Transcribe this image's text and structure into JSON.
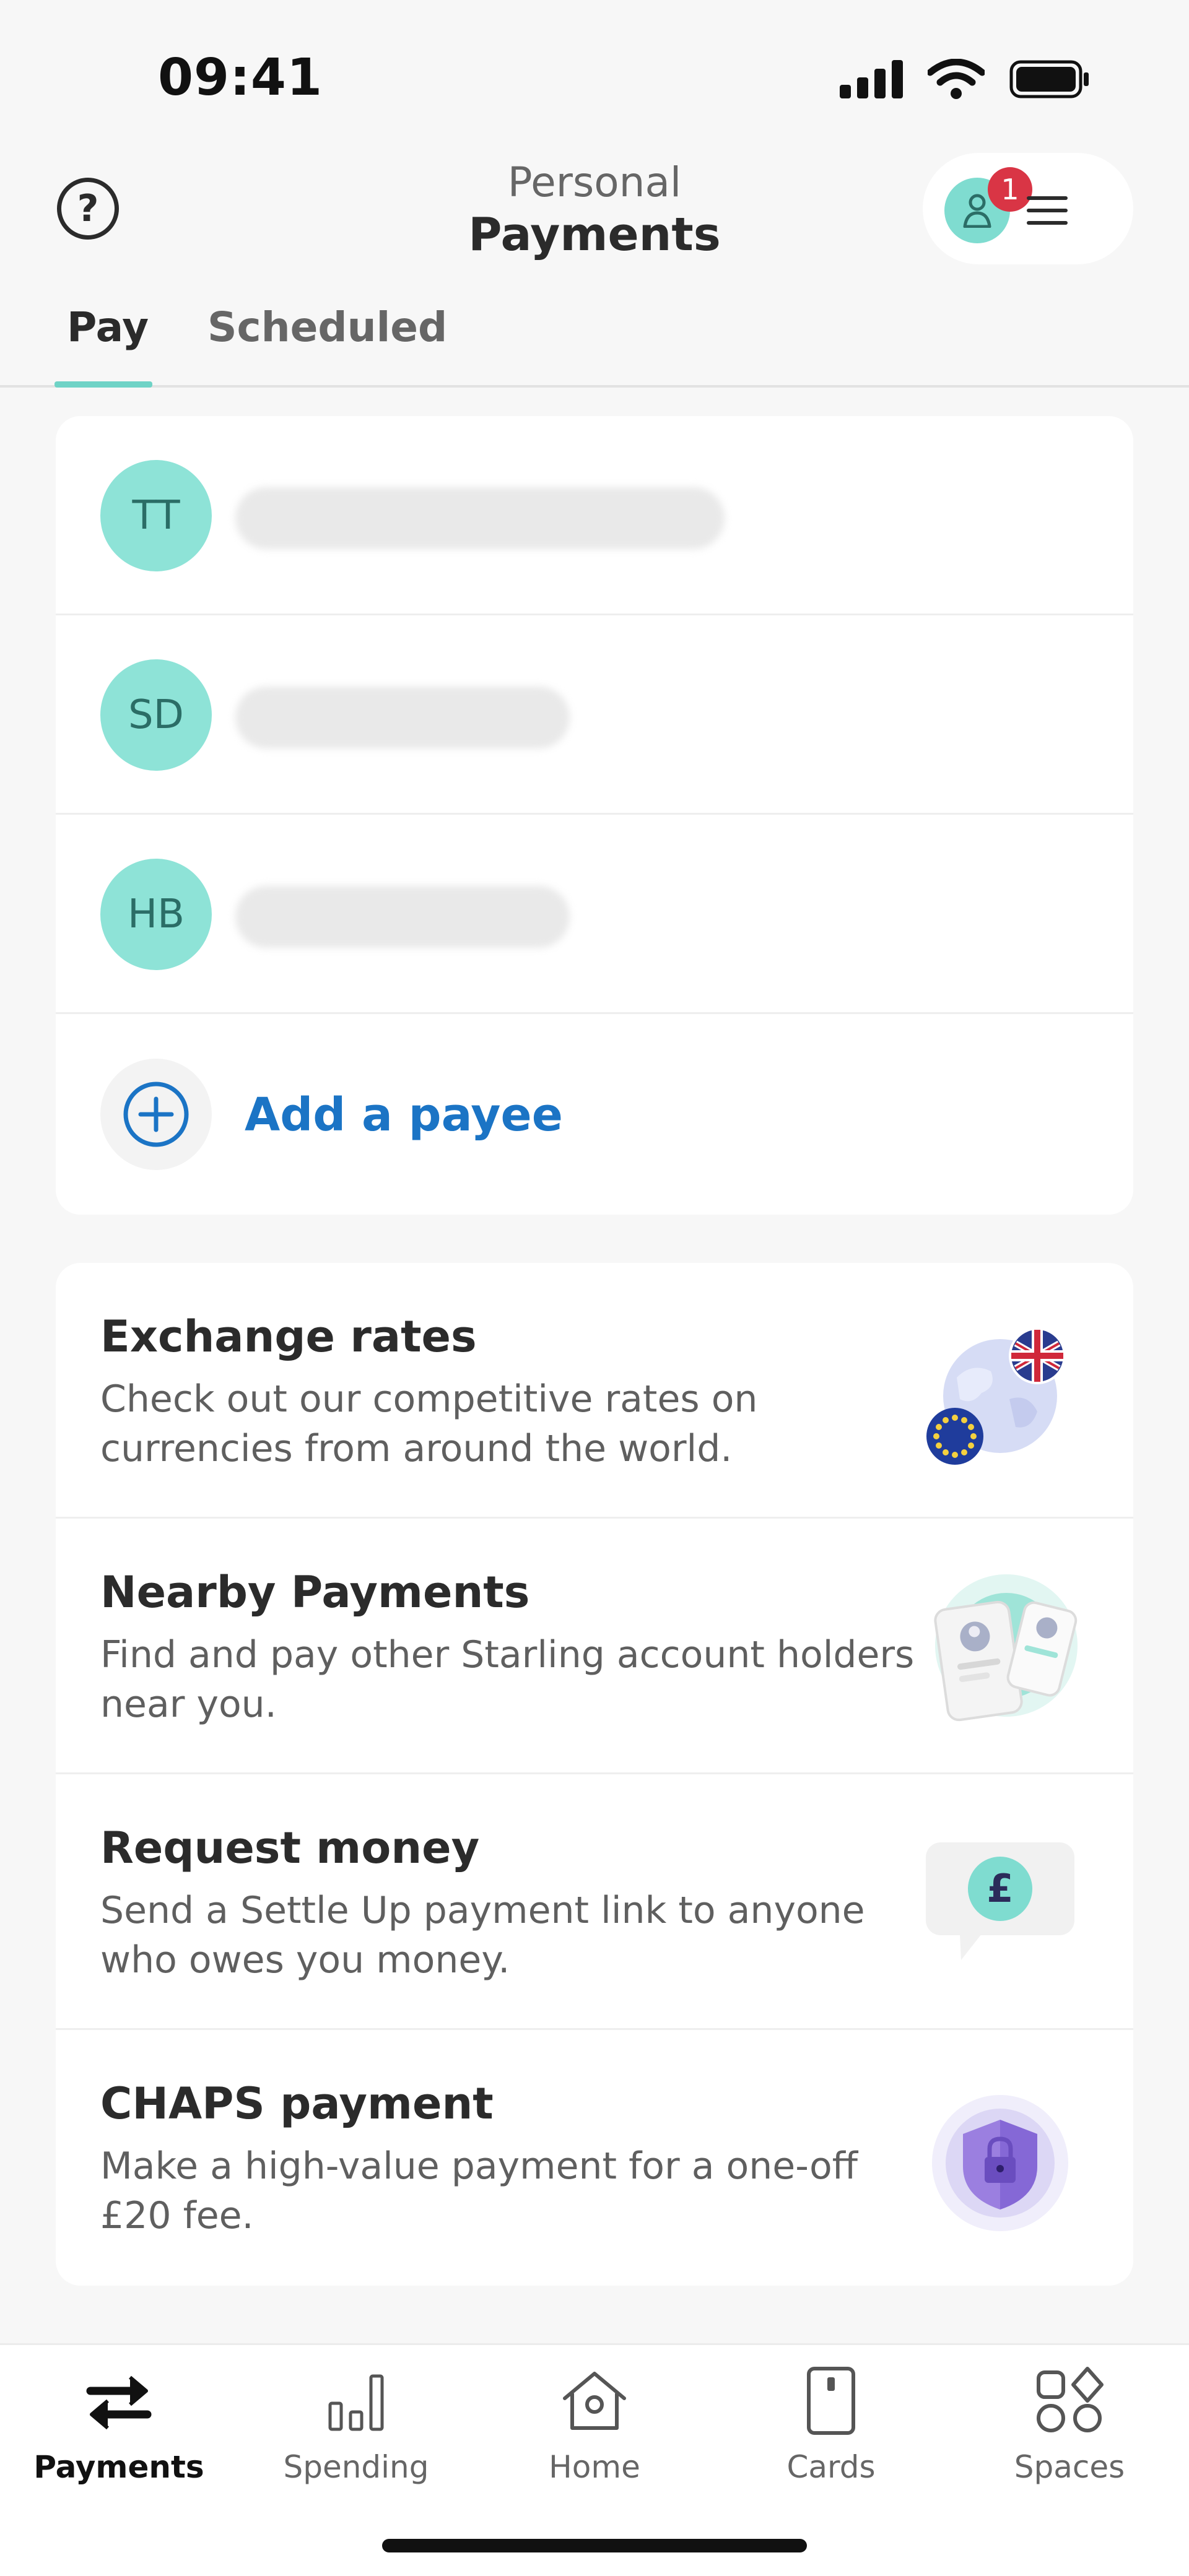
{
  "status_bar": {
    "time": "09:41",
    "icons": [
      "signal-icon",
      "wifi-icon",
      "battery-icon"
    ]
  },
  "header": {
    "subtitle": "Personal",
    "title": "Payments",
    "help_icon": "question-circle-icon",
    "profile_icon": "person-icon",
    "notification_count": "1",
    "menu_icon": "hamburger-menu-icon"
  },
  "tabs": [
    {
      "label": "Pay",
      "active": true
    },
    {
      "label": "Scheduled",
      "active": false
    }
  ],
  "payees": [
    {
      "initials": "TT"
    },
    {
      "initials": "SD"
    },
    {
      "initials": "HB"
    }
  ],
  "add_payee": {
    "label": "Add a payee",
    "icon": "plus-circle-icon"
  },
  "services": [
    {
      "title": "Exchange rates",
      "description": "Check out our competitive rates on currencies from around the world.",
      "icon": "globe-flags-icon"
    },
    {
      "title": "Nearby Payments",
      "description": "Find and pay other Starling account holders near you.",
      "icon": "nearby-phones-icon"
    },
    {
      "title": "Request money",
      "description": "Send a Settle Up payment link to anyone who owes you money.",
      "icon": "pound-speech-bubble-icon"
    },
    {
      "title": "CHAPS payment",
      "description": "Make a high-value payment for a one-off £20 fee.",
      "icon": "shield-lock-icon"
    }
  ],
  "bottom_nav": [
    {
      "label": "Payments",
      "icon": "transfer-arrows-icon",
      "active": true
    },
    {
      "label": "Spending",
      "icon": "bar-chart-icon",
      "active": false
    },
    {
      "label": "Home",
      "icon": "home-icon",
      "active": false
    },
    {
      "label": "Cards",
      "icon": "card-icon",
      "active": false
    },
    {
      "label": "Spaces",
      "icon": "spaces-grid-icon",
      "active": false
    }
  ],
  "colors": {
    "accent_teal": "#6fd3c6",
    "link_blue": "#1b74c5",
    "badge_red": "#d93545",
    "background": "#f7f7f7"
  }
}
